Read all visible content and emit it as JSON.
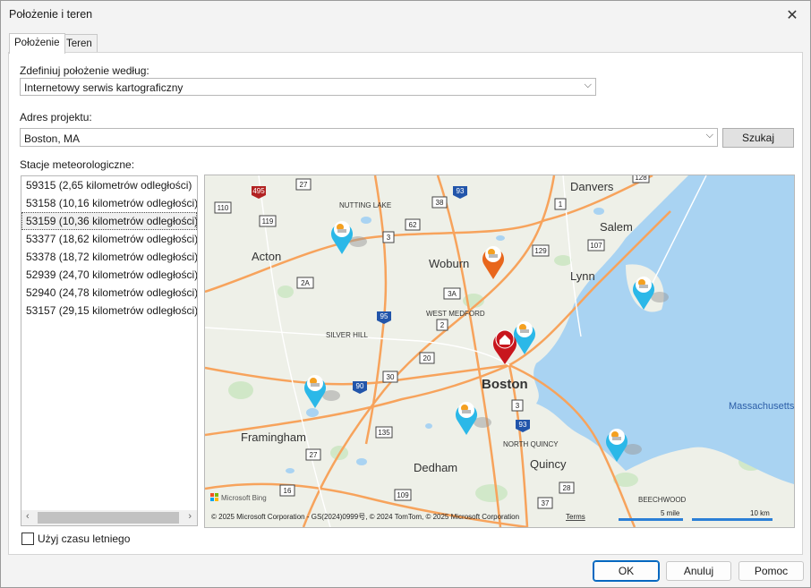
{
  "window": {
    "title": "Położenie i teren"
  },
  "tabs": [
    {
      "label": "Położenie"
    },
    {
      "label": "Teren"
    }
  ],
  "location_mode": {
    "label": "Zdefiniuj położenie według:",
    "value": "Internetowy serwis kartograficzny"
  },
  "address": {
    "label": "Adres projektu:",
    "value": "Boston, MA",
    "search_label": "Szukaj"
  },
  "stations": {
    "label": "Stacje meteorologiczne:",
    "items": [
      "59315 (2,65 kilometrów odległości)",
      "53158 (10,16 kilometrów odległości)",
      "53159 (10,36 kilometrów odległości)",
      "53377 (18,62 kilometrów odległości)",
      "53378 (18,72 kilometrów odległości)",
      "52939 (24,70 kilometrów odległości)",
      "52940 (24,78 kilometrów odległości)",
      "53157 (29,15 kilometrów odległości)"
    ],
    "selected_index": 2
  },
  "map": {
    "places": [
      "Danvers",
      "Salem",
      "Lynn",
      "Acton",
      "Woburn",
      "Boston",
      "Framingham",
      "Dedham",
      "Quincy",
      "Massachusetts"
    ],
    "small_places": [
      "NUTTING LAKE",
      "WEST MEDFORD",
      "SILVER HILL",
      "NORTH QUINCY",
      "BEECHWOOD"
    ],
    "route_shields": [
      "495",
      "27",
      "110",
      "119",
      "93",
      "38",
      "62",
      "3",
      "1",
      "128",
      "129",
      "107",
      "2A",
      "95",
      "3A",
      "2",
      "20",
      "90",
      "30",
      "3",
      "93",
      "135",
      "27",
      "16",
      "109",
      "37",
      "28"
    ],
    "logo": "Microsoft Bing",
    "attribution": "© 2025 Microsoft Corporation - GS(2024)0999号, © 2024 TomTom, © 2025 Microsoft Corporation",
    "terms": "Terms",
    "scale_miles": "5 mile",
    "scale_km": "10 km"
  },
  "daylight": {
    "label": "Użyj czasu letniego",
    "checked": false
  },
  "buttons": {
    "ok": "OK",
    "cancel": "Anuluj",
    "help": "Pomoc"
  },
  "colors": {
    "water": "#a9d3f2",
    "road": "#f7a35c",
    "pin_weather": "#2bb8e8",
    "pin_selected": "#e8661c",
    "pin_home": "#c8161d"
  }
}
